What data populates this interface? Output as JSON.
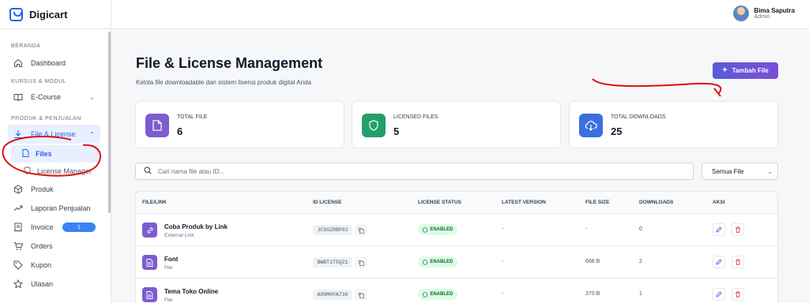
{
  "brand": {
    "name": "Digicart"
  },
  "sidebar": {
    "sections": [
      "BERANDA",
      "KURSUS & MODUL",
      "PRODUK & PENJUALAN"
    ],
    "items": {
      "dashboard": "Dashboard",
      "ecourse": "E-Course",
      "file_license": "File & License",
      "files": "Files",
      "license_manager": "License Manager",
      "produk": "Produk",
      "laporan": "Laporan Penjualan",
      "invoice": "Invoice",
      "invoice_badge": "1",
      "orders": "Orders",
      "kupon": "Kupon",
      "ulasan": "Ulasan"
    }
  },
  "user": {
    "name": "Bima Saputra",
    "role": "Admin"
  },
  "page": {
    "title": "File & License Management",
    "subtitle": "Kelola file downloadable dan sistem lisensi produk digital Anda",
    "add_button": "Tambah File"
  },
  "stats": [
    {
      "label": "TOTAL FILE",
      "value": "6",
      "color": "#7c5ccf",
      "icon": "file-icon"
    },
    {
      "label": "LICENSED FILES",
      "value": "5",
      "color": "#22a06b",
      "icon": "shield-icon"
    },
    {
      "label": "TOTAL DOWNLOADS",
      "value": "25",
      "color": "#3b6fe0",
      "icon": "cloud-download-icon"
    }
  ],
  "search": {
    "placeholder": "Cari nama file atau ID..."
  },
  "filter": {
    "selected": "Semua File"
  },
  "table": {
    "headers": [
      "FILE/LINK",
      "ID LICENSE",
      "LICENSE STATUS",
      "LATEST VERSION",
      "FILE SIZE",
      "DOWNLOADS",
      "AKSI"
    ],
    "rows": [
      {
        "name": "Coba Produk by Link",
        "type": "External Link",
        "icon": "link-icon",
        "license": "JCSGZRBP02",
        "status": "ENABLED",
        "version": "-",
        "size": "-",
        "downloads": "0"
      },
      {
        "name": "Font",
        "type": "File",
        "icon": "file-icon",
        "license": "BWBT1T5QZ1",
        "status": "ENABLED",
        "version": "-",
        "size": "668 B",
        "downloads": "2"
      },
      {
        "name": "Tema Toko Online",
        "type": "File",
        "icon": "file-icon",
        "license": "A99MHYA730",
        "status": "ENABLED",
        "version": "-",
        "size": "370 B",
        "downloads": "1"
      }
    ]
  }
}
